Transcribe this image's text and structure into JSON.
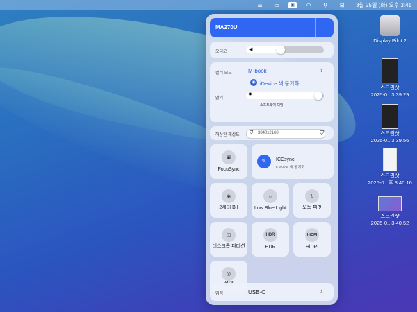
{
  "menubar": {
    "icons": [
      "notification-icon",
      "display-icon",
      "app-icon",
      "wifi-icon",
      "search-icon",
      "control-center-icon"
    ],
    "clock": "3월 25일 (화) 오후 3:41"
  },
  "desktop": [
    {
      "label": "Display Pilot 2"
    },
    {
      "label1": "스크린샷",
      "label2": "2025-0...3.39.29"
    },
    {
      "label1": "스크린샷",
      "label2": "2025-0...3.39.56"
    },
    {
      "label1": "스크린샷",
      "label2": "2025-0...후 3.40.16"
    },
    {
      "label1": "스크린샷",
      "label2": "2025-0...3.40.52"
    }
  ],
  "panel": {
    "monitor": "MA270U",
    "more": "···",
    "audio_label": "오디오",
    "audio_level": 0.5,
    "color_mode_label": "컬러 모드",
    "color_mode_value": "M-book",
    "idevice_sync": "iDevice 색 동기화",
    "brightness_label": "밝기",
    "brightness_level": 0.98,
    "software_dimming": "소프트웨어 디밍",
    "resolution_label": "해상된 해상도",
    "resolution_value": "3840x2160",
    "tiles": {
      "focusync": "FocuSync",
      "iccsync_title": "ICCsync",
      "iccsync_sub": "iDevice 색 동기화",
      "bi": "2세대 B.I",
      "low_blue": "Low Blue Light",
      "auto_pivot": "오토 피벗",
      "desktop_partition": "데스크톱 파티션",
      "hdr": "HDR",
      "hdr_icon": "HDR",
      "hidpi": "HiDPI",
      "hidpi_icon": "HiDPI",
      "eco": "절약"
    },
    "input_label": "입력",
    "input_value": "USB-C"
  }
}
